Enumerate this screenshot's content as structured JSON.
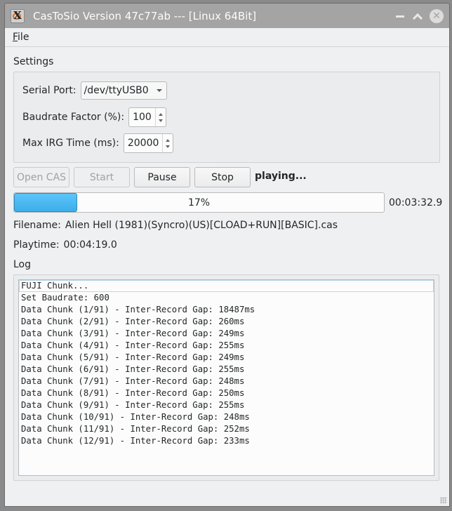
{
  "window": {
    "title": "CasToSio Version 47c77ab --- [Linux 64Bit]",
    "icons": {
      "app": "x-app-icon",
      "minimize": "minimize-icon",
      "maximize": "maximize-icon",
      "close": "close-icon"
    }
  },
  "menubar": {
    "file_mnemonic": "F",
    "file_rest": "ile"
  },
  "settings": {
    "title": "Settings",
    "serial_port_label": "Serial Port:",
    "serial_port_value": "/dev/ttyUSB0",
    "baudrate_label": "Baudrate Factor (%):",
    "baudrate_value": "100",
    "max_irg_label": "Max IRG Time (ms):",
    "max_irg_value": "20000"
  },
  "controls": {
    "open_cas": "Open CAS",
    "start": "Start",
    "pause": "Pause",
    "stop": "Stop",
    "status": "playing..."
  },
  "progress": {
    "percent": 17,
    "label": "17%",
    "elapsed": "00:03:32.9"
  },
  "info": {
    "filename_label": "Filename:",
    "filename_value": "Alien Hell (1981)(Syncro)(US)[CLOAD+RUN][BASIC].cas",
    "playtime_label": "Playtime:",
    "playtime_value": "00:04:19.0"
  },
  "log": {
    "title": "Log",
    "lines": [
      "FUJI Chunk...",
      "Set Baudrate: 600",
      "Data Chunk (1/91) - Inter-Record Gap: 18487ms",
      "Data Chunk (2/91) - Inter-Record Gap: 260ms",
      "Data Chunk (3/91) - Inter-Record Gap: 249ms",
      "Data Chunk (4/91) - Inter-Record Gap: 255ms",
      "Data Chunk (5/91) - Inter-Record Gap: 249ms",
      "Data Chunk (6/91) - Inter-Record Gap: 255ms",
      "Data Chunk (7/91) - Inter-Record Gap: 248ms",
      "Data Chunk (8/91) - Inter-Record Gap: 250ms",
      "Data Chunk (9/91) - Inter-Record Gap: 255ms",
      "Data Chunk (10/91) - Inter-Record Gap: 248ms",
      "Data Chunk (11/91) - Inter-Record Gap: 252ms",
      "Data Chunk (12/91) - Inter-Record Gap: 233ms"
    ]
  }
}
